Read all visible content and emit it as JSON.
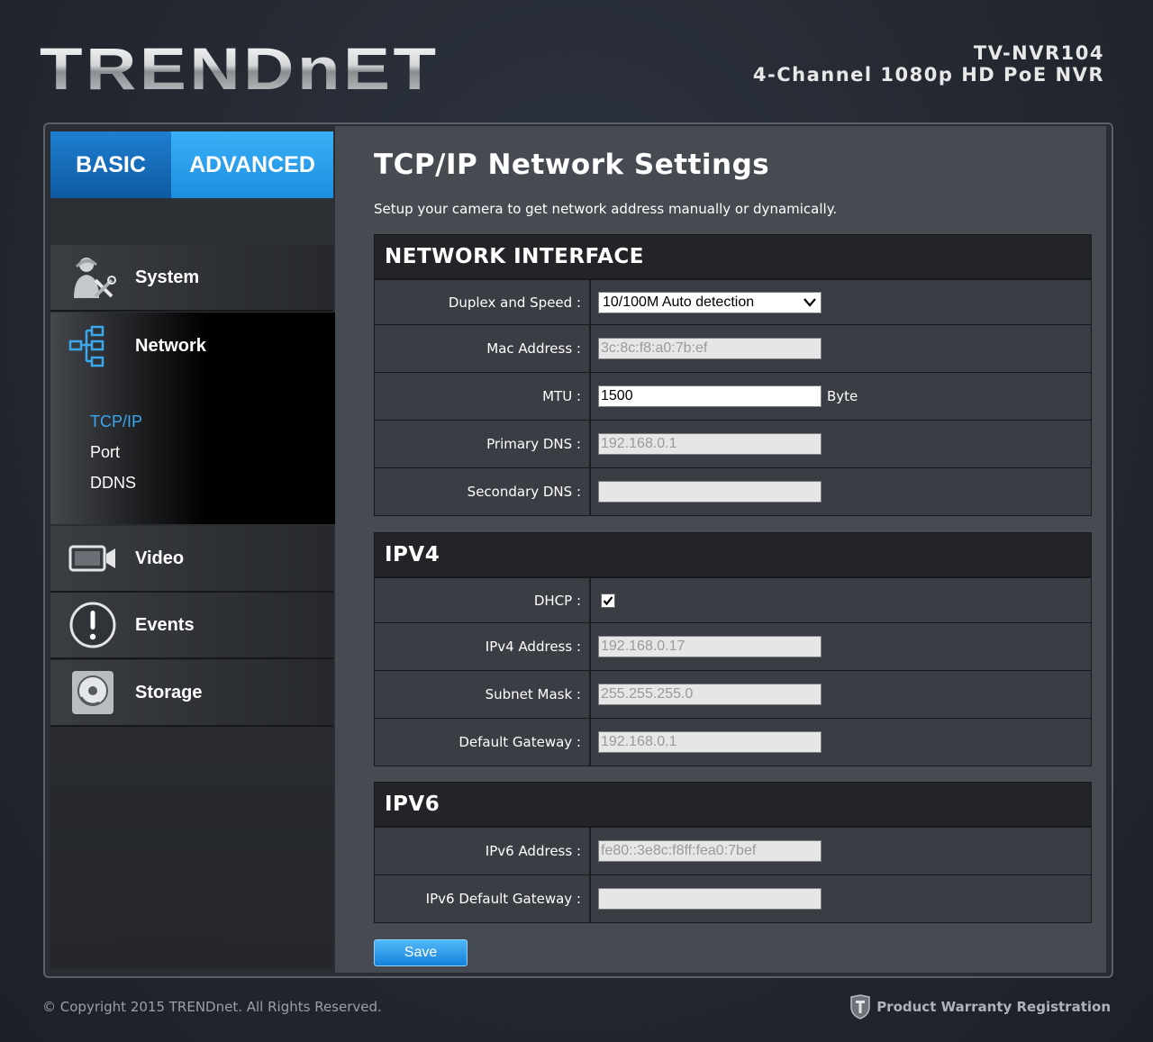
{
  "brand": {
    "logo": "TRENDnET",
    "model": "TV-NVR104",
    "product": "4-Channel 1080p HD PoE NVR"
  },
  "tabs": {
    "basic": "BASIC",
    "advanced": "ADVANCED"
  },
  "sidebar": {
    "system": "System",
    "network": "Network",
    "network_sub": [
      "TCP/IP",
      "Port",
      "DDNS"
    ],
    "video": "Video",
    "events": "Events",
    "storage": "Storage"
  },
  "page": {
    "title": "TCP/IP Network Settings",
    "description": "Setup your camera to get network address manually or dynamically."
  },
  "network_interface": {
    "heading": "NETWORK INTERFACE",
    "duplex_label": "Duplex and Speed :",
    "duplex_value": "10/100M Auto detection",
    "mac_label": "Mac Address :",
    "mac_value": "3c:8c:f8:a0:7b:ef",
    "mtu_label": "MTU :",
    "mtu_value": "1500",
    "mtu_unit": "Byte",
    "primary_dns_label": "Primary DNS :",
    "primary_dns_value": "192.168.0.1",
    "secondary_dns_label": "Secondary DNS :",
    "secondary_dns_value": ""
  },
  "ipv4": {
    "heading": "IPV4",
    "dhcp_label": "DHCP :",
    "dhcp_checked": true,
    "address_label": "IPv4 Address :",
    "address_value": "192.168.0.17",
    "mask_label": "Subnet Mask :",
    "mask_value": "255.255.255.0",
    "gateway_label": "Default Gateway :",
    "gateway_value": "192.168.0.1"
  },
  "ipv6": {
    "heading": "IPV6",
    "address_label": "IPv6 Address :",
    "address_value": "fe80::3e8c:f8ff:fea0:7bef",
    "gateway_label": "IPv6 Default Gateway :",
    "gateway_value": ""
  },
  "save_label": "Save",
  "footer": {
    "copyright": "© Copyright 2015 TRENDnet. All Rights Reserved.",
    "warranty": "Product Warranty Registration"
  },
  "colors": {
    "accent": "#1c8ee0",
    "active_link": "#3aa8ef",
    "panel": "#464a51"
  }
}
